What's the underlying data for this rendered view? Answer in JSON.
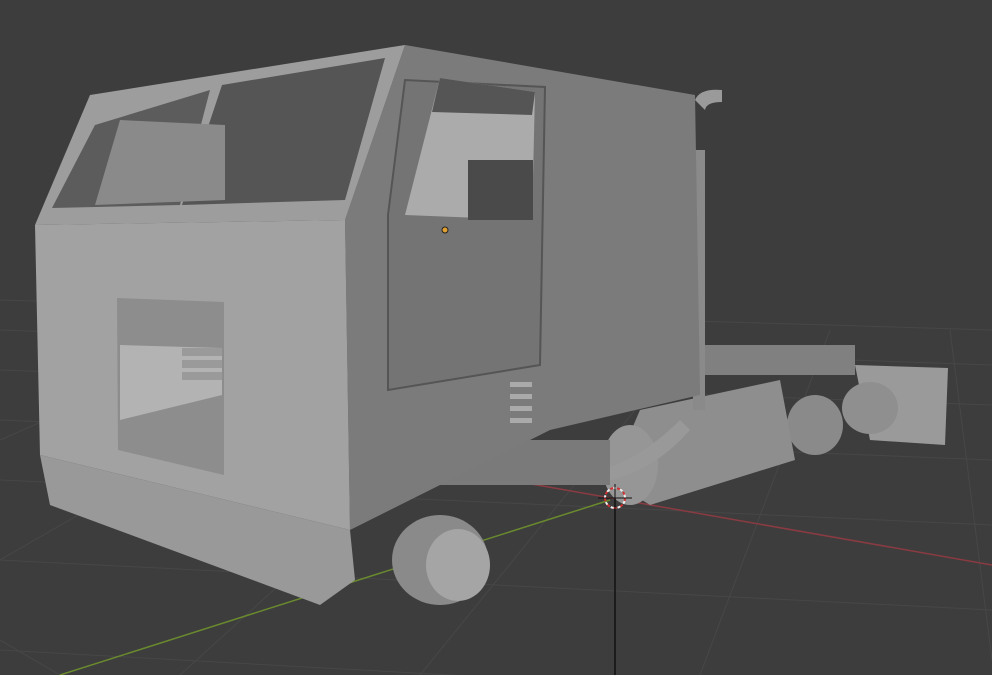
{
  "viewport": {
    "background": "#3d3d3d",
    "grid_color": "#474747",
    "x_axis_color": "#8a3b42",
    "y_axis_color": "#6a8a2e",
    "model_base_color": "#8c8c8c",
    "origin_marker_color": "#e0a030",
    "cursor_color": "#d03030"
  }
}
